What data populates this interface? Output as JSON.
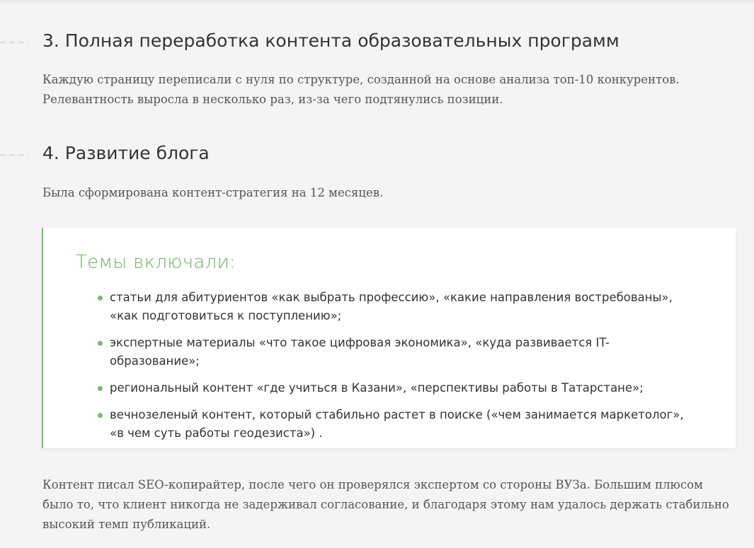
{
  "sections": [
    {
      "heading": "3. Полная переработка контента образовательных программ",
      "text": "Каждую страницу переписали с нуля по структуре, созданной на основе анализа топ-10 конкурентов. Релевантность выросла в несколько раз, из-за чего подтянулись позиции."
    },
    {
      "heading": "4. Развитие блога",
      "text": "Была сформирована контент-стратегия на 12 месяцев."
    }
  ],
  "topics_card": {
    "title": "Темы включали:",
    "items": [
      "статьи для абитуриентов «как выбрать профессию», «какие направления востребованы», «как подготовиться к поступлению»;",
      "экспертные материалы «что такое цифровая экономика», «куда развивается IT-образование»;",
      "региональный контент «где учиться в Казани», «перспективы работы в Татарстане»;",
      "вечнозеленый контент, который стабильно растет в поиске («чем занимается маркетолог», «в чем суть работы геодезиста») ."
    ]
  },
  "closing_text": "Контент писал SEO-копирайтер, после чего он проверялся экспертом со стороны ВУЗа. Большим плюсом было то, что клиент никогда не задерживал согласование, и благодаря этому нам удалось держать стабильно высокий темп публикаций.",
  "colors": {
    "accent": "#7cb96f",
    "accent_text": "#6db05f",
    "background": "#f4f4f4"
  }
}
